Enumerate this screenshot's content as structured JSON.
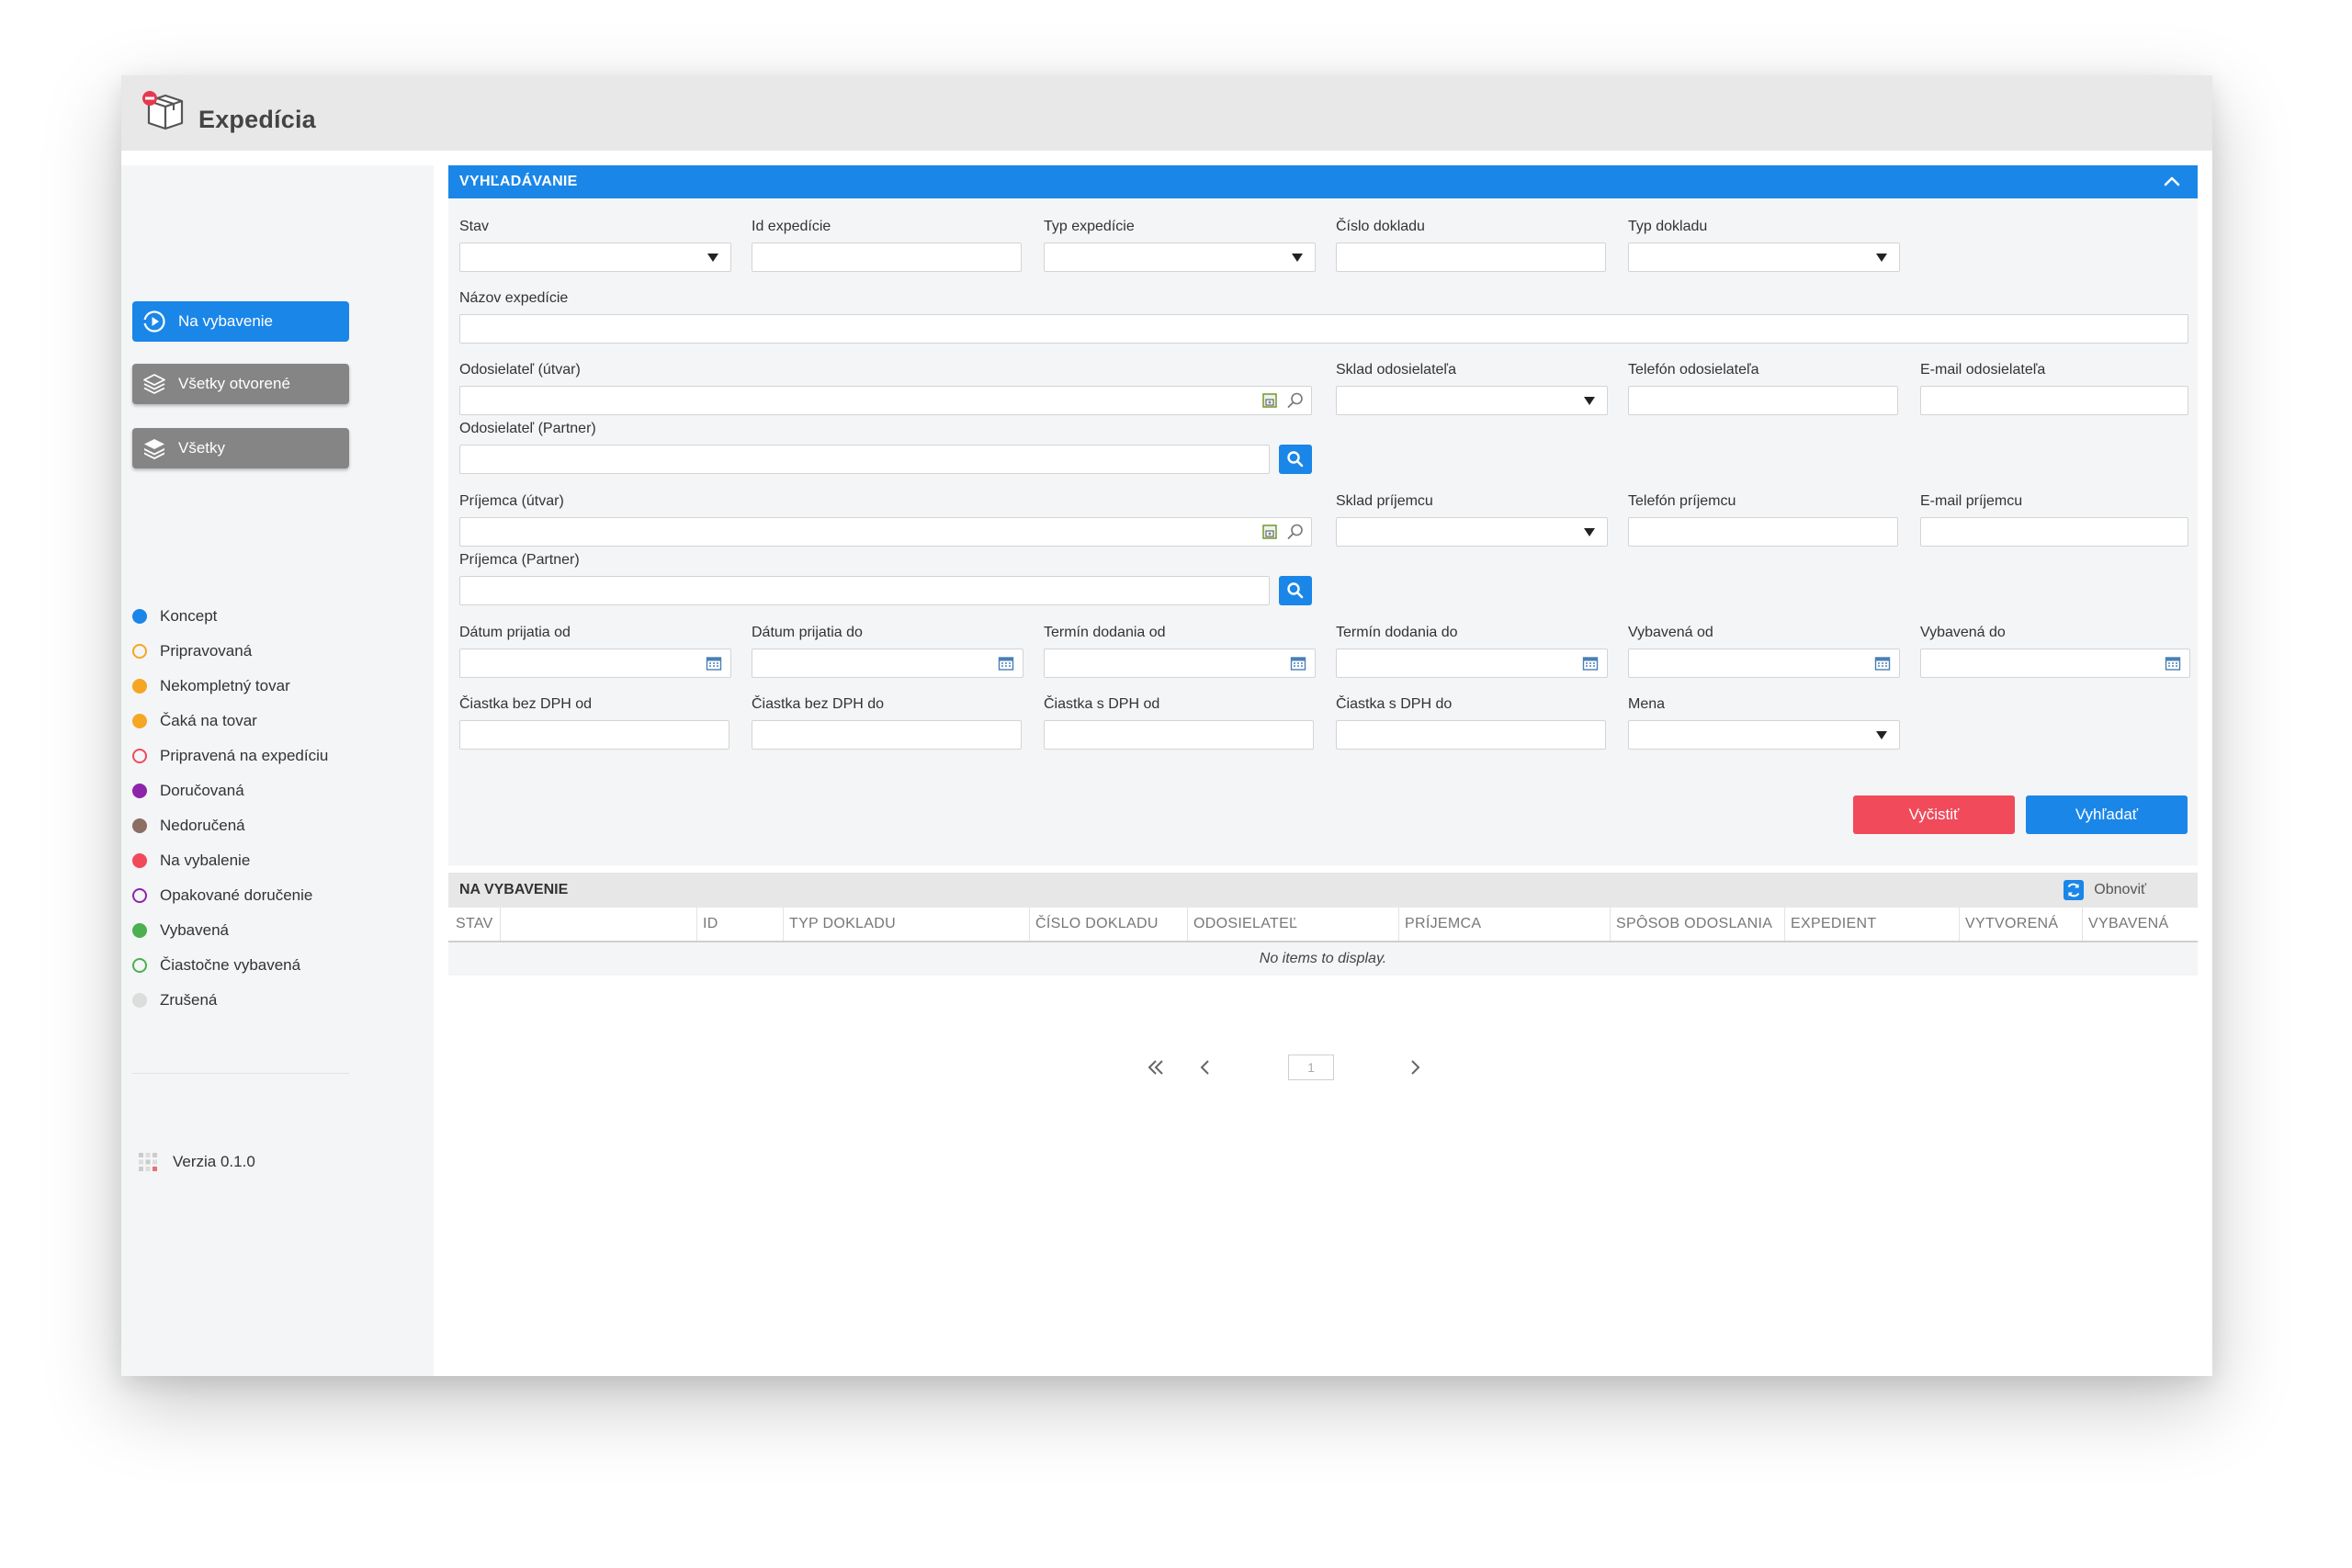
{
  "app": {
    "title": "Expedícia",
    "icon": "package-box-icon"
  },
  "sidebar": {
    "nav": [
      {
        "label": "Na vybavenie",
        "icon": "play-circle-icon"
      },
      {
        "label": "Všetky otvorené",
        "icon": "layers-icon"
      },
      {
        "label": "Všetky",
        "icon": "layers-filled-icon"
      }
    ],
    "legend": [
      {
        "label": "Koncept",
        "color": "#1a86e8",
        "filled": true
      },
      {
        "label": "Pripravovaná",
        "color": "#f5a623",
        "filled": false
      },
      {
        "label": "Nekompletný tovar",
        "color": "#f5a623",
        "filled": true
      },
      {
        "label": "Čaká na tovar",
        "color": "#f5a623",
        "filled": true
      },
      {
        "label": "Pripravená na expedíciu",
        "color": "#f04a5b",
        "filled": false
      },
      {
        "label": "Doručovaná",
        "color": "#8e24aa",
        "filled": true
      },
      {
        "label": "Nedoručená",
        "color": "#8d6e63",
        "filled": true
      },
      {
        "label": "Na vybalenie",
        "color": "#f04a5b",
        "filled": true
      },
      {
        "label": "Opakované doručenie",
        "color": "#8e24aa",
        "filled": false
      },
      {
        "label": "Vybavená",
        "color": "#4caf50",
        "filled": true
      },
      {
        "label": "Čiastočne vybavená",
        "color": "#4caf50",
        "filled": false
      },
      {
        "label": "Zrušená",
        "color": "#dcdcdc",
        "filled": true
      }
    ],
    "version": "Verzia 0.1.0"
  },
  "search": {
    "header": "VYHĽADÁVANIE",
    "labels": {
      "stav": "Stav",
      "id_expedicie": "Id expedície",
      "typ_expedicie": "Typ expedície",
      "cislo_dokladu": "Číslo dokladu",
      "typ_dokladu": "Typ dokladu",
      "nazov_expedicie": "Názov expedície",
      "odosielatel_utvar": "Odosielateľ (útvar)",
      "sklad_odosielatela": "Sklad odosielateľa",
      "telefon_odosielatela": "Telefón odosielateľa",
      "email_odosielatela": "E-mail odosielateľa",
      "odosielatel_partner": "Odosielateľ (Partner)",
      "prijemca_utvar": "Príjemca (útvar)",
      "sklad_prijemcu": "Sklad príjemcu",
      "telefon_prijemcu": "Telefón príjemcu",
      "email_prijemcu": "E-mail príjemcu",
      "prijemca_partner": "Príjemca (Partner)",
      "datum_prijatia_od": "Dátum prijatia od",
      "datum_prijatia_do": "Dátum prijatia do",
      "termin_dodania_od": "Termín dodania od",
      "termin_dodania_do": "Termín dodania do",
      "vybavena_od": "Vybavená od",
      "vybavena_do": "Vybavená do",
      "ciastka_bez_dph_od": "Čiastka bez DPH od",
      "ciastka_bez_dph_do": "Čiastka bez DPH do",
      "ciastka_s_dph_od": "Čiastka s DPH od",
      "ciastka_s_dph_do": "Čiastka s DPH do",
      "mena": "Mena"
    },
    "values": {
      "empty": ""
    },
    "buttons": {
      "clear": "Vyčistiť",
      "search": "Vyhľadať"
    }
  },
  "results": {
    "header": "NA VYBAVENIE",
    "refresh_label": "Obnoviť",
    "columns": [
      "STAV",
      "ID",
      "TYP DOKLADU",
      "ČÍSLO DOKLADU",
      "ODOSIELATEĽ",
      "PRÍJEMCA",
      "SPÔSOB ODOSLANIA",
      "EXPEDIENT",
      "VYTVORENÁ",
      "VYBAVENÁ"
    ],
    "empty_message": "No items to display.",
    "pagination": {
      "current_page": "1"
    }
  },
  "colors": {
    "accent": "#1a86e8",
    "danger": "#f04a5b",
    "nav_grey": "#858585"
  }
}
